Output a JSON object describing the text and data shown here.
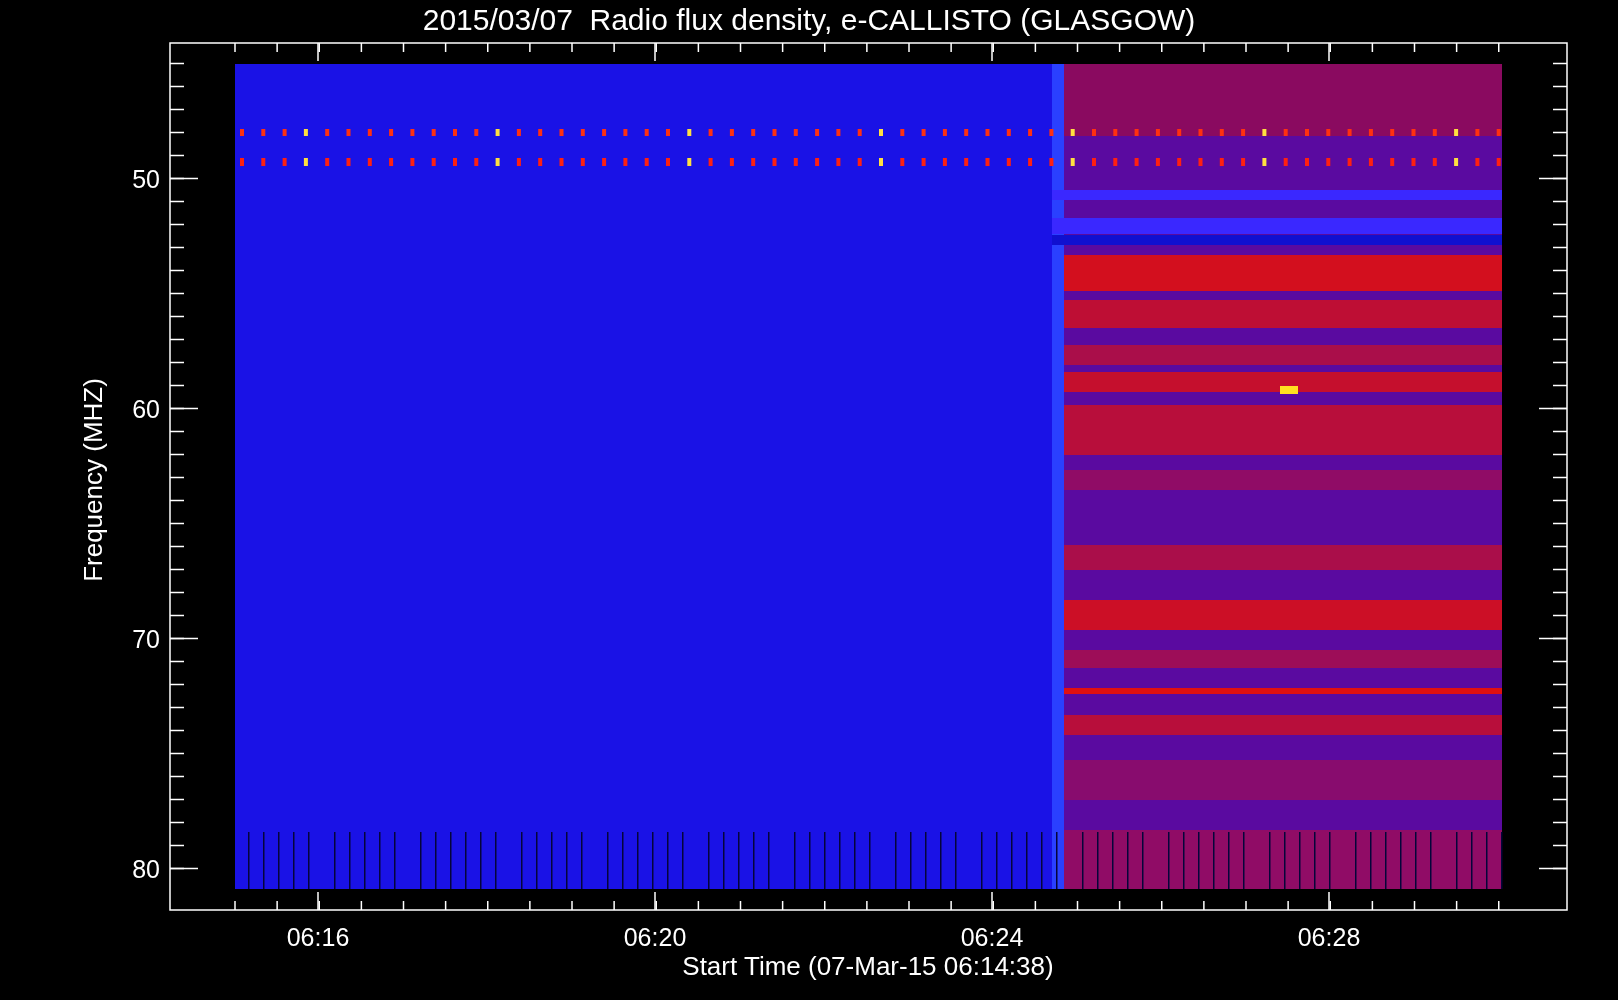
{
  "title": "2015/03/07  Radio flux density, e-CALLISTO (GLASGOW)",
  "plot": {
    "y_axis": {
      "label": "Frequency (MHZ)",
      "tick_labels": [
        "50",
        "60",
        "70",
        "80"
      ]
    },
    "x_axis": {
      "label": "Start Time (07-Mar-15 06:14:38)",
      "tick_labels": [
        "06:16",
        "06:20",
        "06:24",
        "06:28"
      ]
    }
  }
}
